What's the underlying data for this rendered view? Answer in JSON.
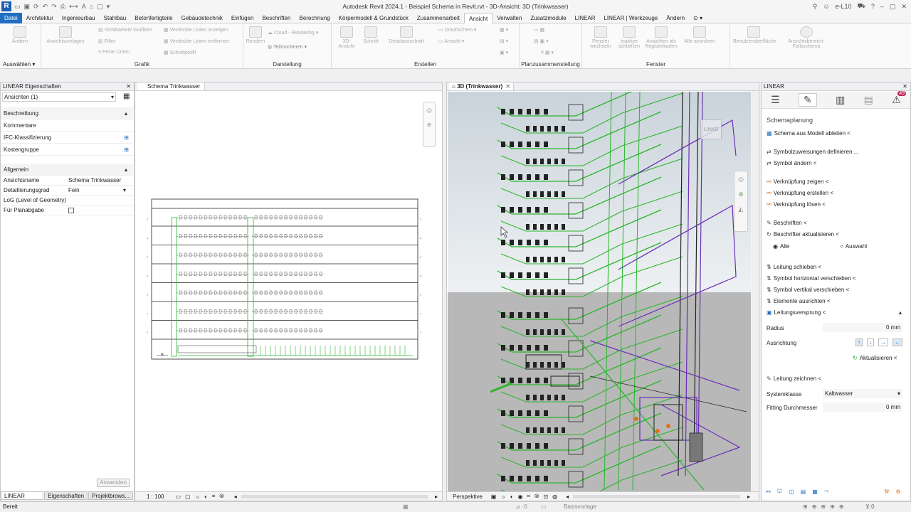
{
  "app": {
    "title": "Autodesk Revit 2024.1 - Beispiel Schema in Revit.rvt - 3D-Ansicht: 3D (Trinkwasser)",
    "logo": "R",
    "user": "e-L10"
  },
  "menu": {
    "tabs": [
      "Datei",
      "Architektur",
      "Ingenieurbau",
      "Stahlbau",
      "Betonfertigteile",
      "Gebäudetechnik",
      "Einfügen",
      "Beschriften",
      "Berechnung",
      "Körpermodell & Grundstück",
      "Zusammenarbeit",
      "Ansicht",
      "Verwalten",
      "Zusatzmodule",
      "LINEAR",
      "LINEAR | Werkzeuge",
      "Ändern"
    ],
    "active": "Ansicht"
  },
  "ribbon": {
    "groups": {
      "auswaehlen": "Auswählen",
      "grafik": "Grafik",
      "darstellung": "Darstellung",
      "erstellen": "Erstellen",
      "planzusammenstellung": "Planzusammenstellung",
      "fenster": "Fenster"
    },
    "buttons": {
      "aendern": "Ändern",
      "ansichtsvorlagen": "Ansichtsvorlagen",
      "sichtbarkeit": "Sichtbarkeit/ Grafiken",
      "filter": "Filter",
      "feine_linien": "Feine Linien",
      "verdeckte_anzeigen": "Verdeckte Linien anzeigen",
      "verdeckte_entfernen": "Verdeckte Linien entfernen",
      "schnittprofil": "Schnittprofil",
      "rendern": "Rendern",
      "cloud_rendering": "Cloud - Rendering",
      "teilmontieren": "Teilmontieren",
      "ansicht_3d": "3D-Ansicht",
      "schnitt": "Schnitt",
      "detailausschnitt": "Detailausschnitt",
      "draufsichten": "Draufsichten",
      "ansicht": "Ansicht",
      "fenster_wechseln": "Fenster wechseln",
      "inaktive_schliessen": "Inaktive schließen",
      "ansichten_register": "Ansichten als Registerkarten",
      "alle_anordnen": "Alle anordnen",
      "benutzeroberflaeche": "Benutzeroberfläche",
      "ansichtsbereich_farbschema": "Ansichtsbereich-Farbschema"
    }
  },
  "properties": {
    "title": "LINEAR Eigenschaften",
    "selector": "Ansichten (1)",
    "section_beschreibung": "Beschreibung",
    "kommentare": "Kommentare",
    "ifc": "IFC-Klassifizierung",
    "kostengruppe": "Kostengruppe",
    "section_allgemein": "Allgemein",
    "ansichtsname_label": "Ansichtsname",
    "ansichtsname_value": "Schema Trinkwasser",
    "detailgrad_label": "Detaillierungsgrad",
    "detailgrad_value": "Fein",
    "log_label": "LoG (Level of Geometry)",
    "planabgabe_label": "Für Planabgabe",
    "apply": "Anwenden",
    "bottom_tabs": [
      "LINEAR Eigen...",
      "Eigenschaften",
      "Projektbrows..."
    ]
  },
  "views": {
    "schema_tab": "Schema Trinkwasser",
    "threed_tab": "3D (Trinkwasser)",
    "scale": "1 : 100",
    "perspective": "Perspektive",
    "cube_label": "LINKS"
  },
  "linear": {
    "title": "LINEAR",
    "badge": "49",
    "heading": "Schemaplanung",
    "items": [
      "Schema aus Modell ableiten <",
      "Symbolzuweisungen definieren ...",
      "Symbol ändern <",
      "Verknüpfung zeigen <",
      "Verknüpfung erstellen <",
      "Verknüpfung lösen <",
      "Beschriften <",
      "Beschrifter aktualisieren <"
    ],
    "radio_alle": "Alle",
    "radio_auswahl": "Auswahl",
    "items2": [
      "Leitung schieben <",
      "Symbol horizontal verschieben <",
      "Symbol vertikal verschieben <",
      "Elemente ausrichten <"
    ],
    "leitungsversprung": "Leitungsversprung <",
    "radius_label": "Radius",
    "radius_value": "0 mm",
    "ausrichtung_label": "Ausrichtung",
    "aktualisieren": "Aktualisieren <",
    "leitung_zeichnen": "Leitung zeichnen <",
    "systemklasse_label": "Systemklasse",
    "systemklasse_value": "Kaltwasser",
    "fitting_label": "Fitting Durchmesser",
    "fitting_value": "0 mm"
  },
  "status": {
    "left": "Bereit",
    "coord": ":0",
    "basis": "Basisvorlage"
  },
  "colors": {
    "accent": "#1f6fc0",
    "pipe_green": "#2bb52b",
    "pipe_purple": "#6a2fb5",
    "viewport_top": "#dfe6ea",
    "viewport_bottom": "#b9b9b9"
  }
}
